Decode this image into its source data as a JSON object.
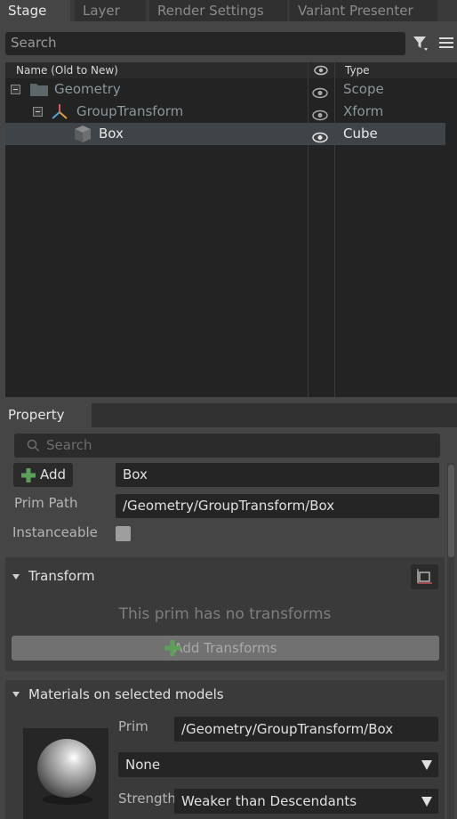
{
  "tabs": [
    {
      "label": "Stage",
      "active": true
    },
    {
      "label": "Layer",
      "active": false
    },
    {
      "label": "Render Settings",
      "active": false
    },
    {
      "label": "Variant Presenter",
      "active": false
    }
  ],
  "stage_search": {
    "placeholder": "Search"
  },
  "tree": {
    "columns": {
      "name": "Name (Old to New)",
      "type": "Type"
    },
    "rows": [
      {
        "name": "Geometry",
        "type": "Scope",
        "icon": "folder-icon",
        "selected": false
      },
      {
        "name": "GroupTransform",
        "type": "Xform",
        "icon": "xform-icon",
        "selected": false
      },
      {
        "name": "Box",
        "type": "Cube",
        "icon": "cube-icon",
        "selected": true
      }
    ]
  },
  "property": {
    "tab_label": "Property",
    "search_placeholder": "Search",
    "add_label": "Add",
    "prim_name": "Box",
    "prim_path_label": "Prim Path",
    "prim_path": "/Geometry/GroupTransform/Box",
    "instanceable_label": "Instanceable",
    "instanceable": false,
    "transform": {
      "title": "Transform",
      "empty_message": "This prim has no transforms",
      "add_label": "Add Transforms"
    },
    "materials": {
      "title": "Materials on selected models",
      "prim_label": "Prim",
      "prim_value": "/Geometry/GroupTransform/Box",
      "material_value": "None",
      "strength_label": "Strength",
      "strength_value": "Weaker than Descendants"
    }
  },
  "colors": {
    "accent_green": "#5aa05a",
    "selection": "#3f4448"
  }
}
